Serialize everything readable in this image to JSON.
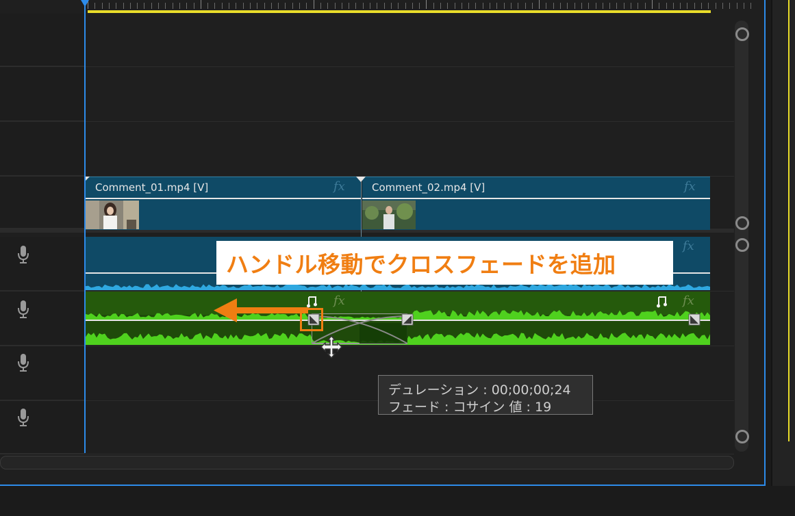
{
  "tracks": {
    "video_clips": [
      {
        "name": "Comment_01.mp4 [V]",
        "fx": "fx"
      },
      {
        "name": "Comment_02.mp4 [V]",
        "fx": "fx"
      }
    ],
    "audio_fx": [
      "fx",
      "fx",
      "fx",
      "fx"
    ]
  },
  "annotation": {
    "callout_text": "ハンドル移動でクロスフェードを追加"
  },
  "tooltip": {
    "line1": "デュレーション : 00;00;00;24",
    "line2": "フェード : コサイン 値 : 19"
  },
  "colors": {
    "accent": "#2d8ceb",
    "work_area": "#e8dc2a",
    "video_clip": "#0f4a66",
    "audio_clip_green": "#255a0c",
    "waveform_green": "#4fd11e",
    "waveform_blue": "#2fa8e0",
    "callout_orange": "#f07e12"
  },
  "icons": [
    "microphone-icon",
    "music-note-icon",
    "fx-badge-icon",
    "move-cursor-icon",
    "fade-handle-icon",
    "arrow-left-icon"
  ]
}
